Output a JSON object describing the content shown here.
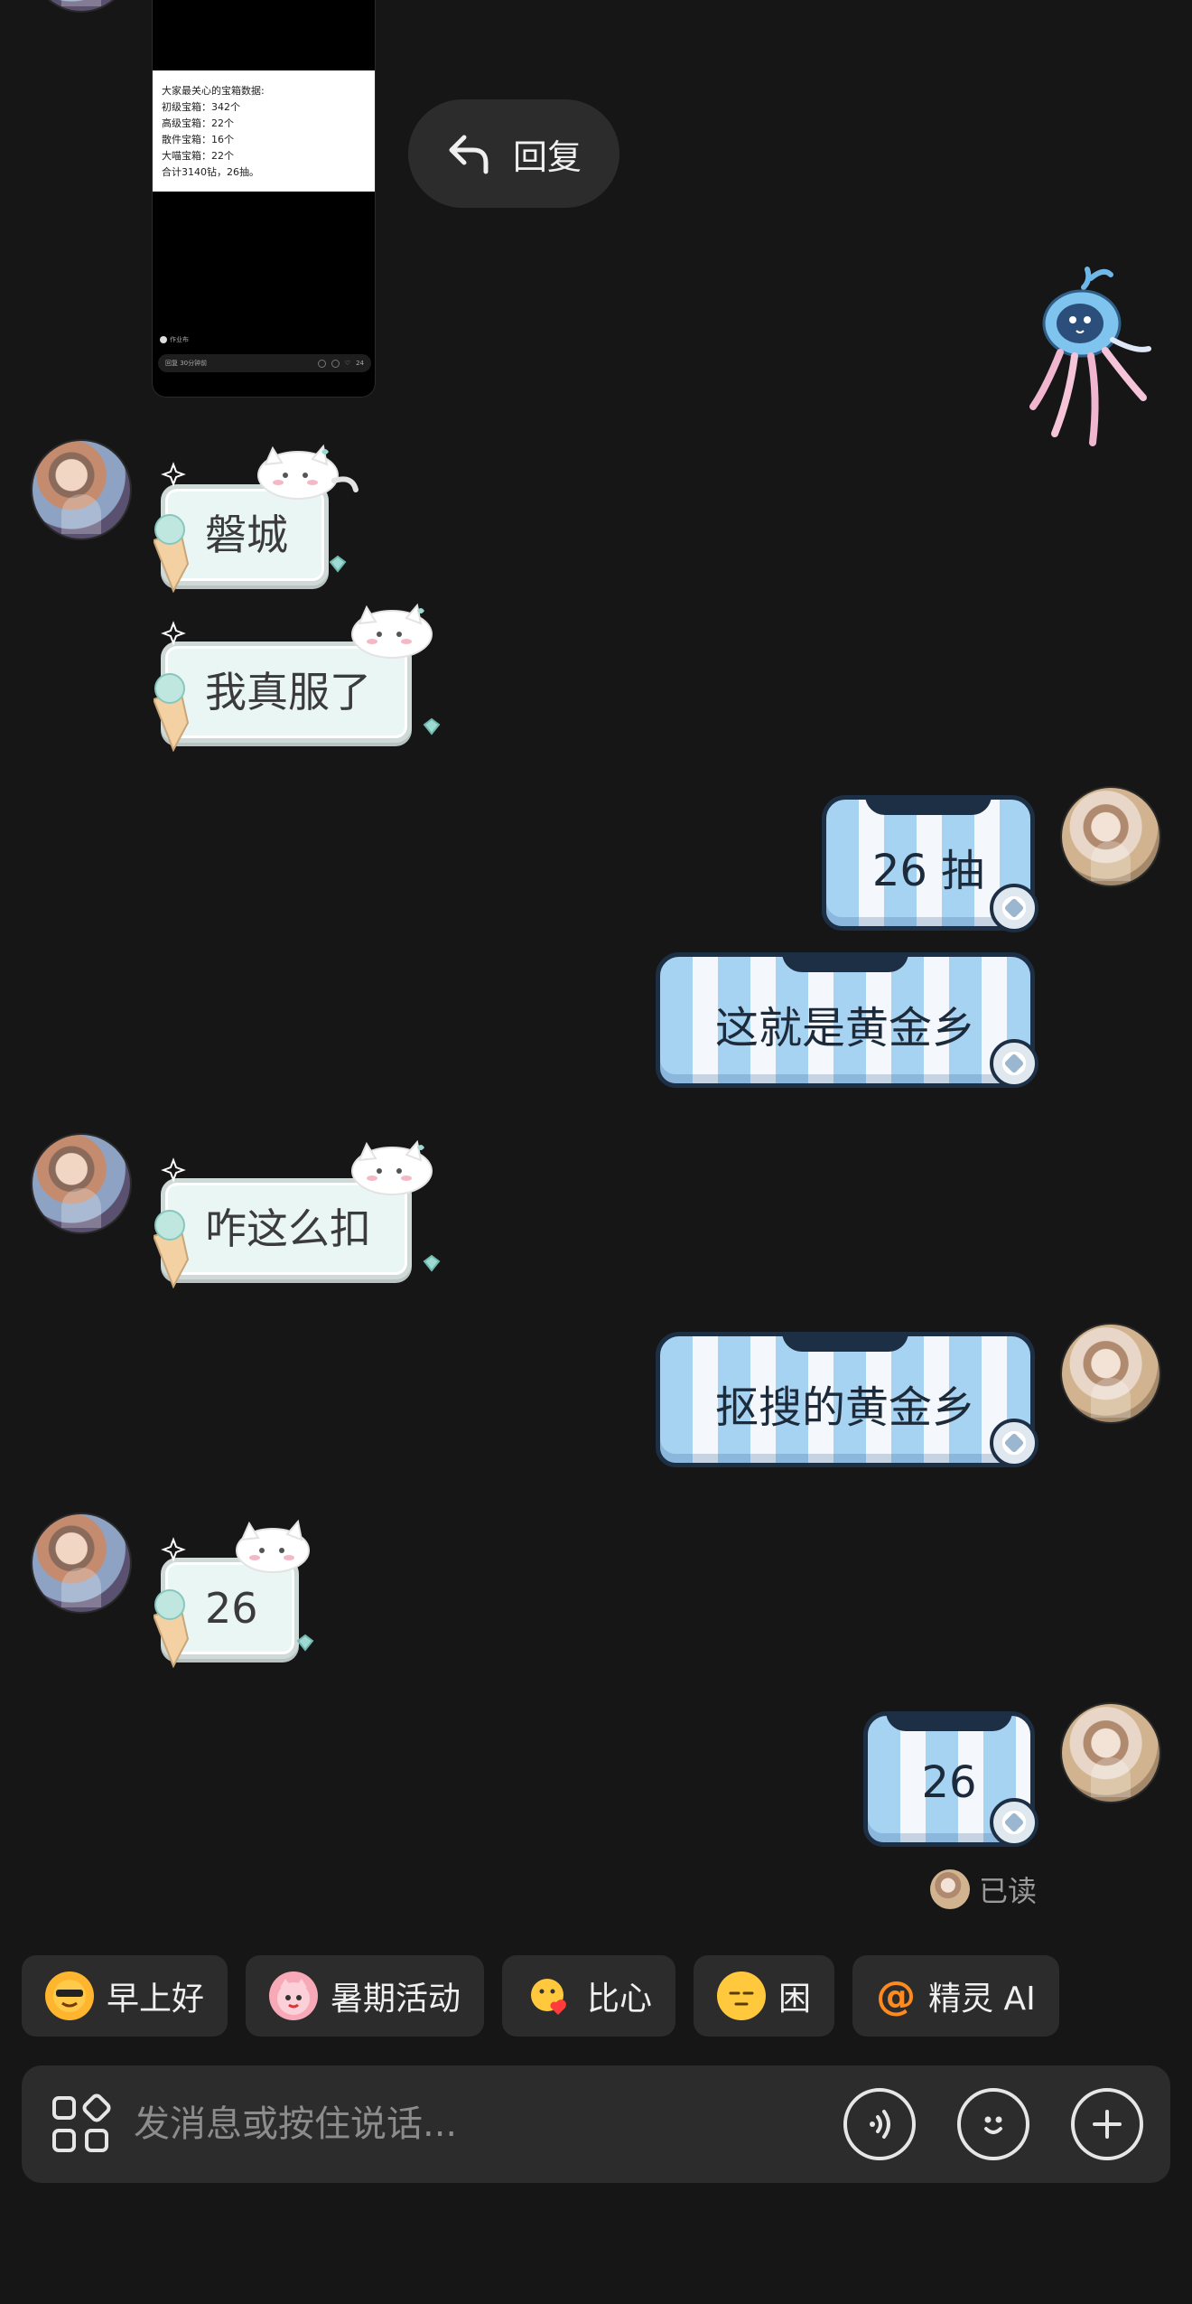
{
  "shared_post": {
    "text_lines": [
      "大家最关心的宝箱数据:",
      "初级宝箱：342个",
      "高级宝箱：22个",
      "散件宝箱：16个",
      "大喵宝箱：22个",
      "合计3140钻，26抽。"
    ],
    "footer_note": "作业布",
    "comment_placeholder": "回复 30分钟前",
    "like_count": "24"
  },
  "reply_action": {
    "label": "回复"
  },
  "messages": [
    {
      "side": "left",
      "text": "磐城"
    },
    {
      "side": "left",
      "text": "我真服了"
    },
    {
      "side": "right",
      "text": "26 抽"
    },
    {
      "side": "right",
      "text": "这就是黄金乡"
    },
    {
      "side": "left",
      "text": "咋这么扣"
    },
    {
      "side": "right",
      "text": "抠搜的黄金乡"
    },
    {
      "side": "left",
      "text": "26"
    },
    {
      "side": "right",
      "text": "26"
    }
  ],
  "read_status": "已读",
  "quick_replies": [
    {
      "label": "早上好",
      "icon": "sun-sunglasses-icon",
      "color": "#ffb52e"
    },
    {
      "label": "暑期活动",
      "icon": "pink-cat-icon",
      "color": "#f7a9b8"
    },
    {
      "label": "比心",
      "icon": "heart-hands-icon",
      "color": "#ffb02e"
    },
    {
      "label": "困",
      "icon": "sleepy-face-icon",
      "color": "#ffc83d"
    },
    {
      "label": "精灵 AI",
      "icon": "at-icon",
      "color": "#ff8a1d"
    }
  ],
  "composer": {
    "placeholder": "发消息或按住说话...",
    "icons": [
      "apps-icon",
      "voice-icon",
      "emoji-icon",
      "plus-icon"
    ]
  }
}
